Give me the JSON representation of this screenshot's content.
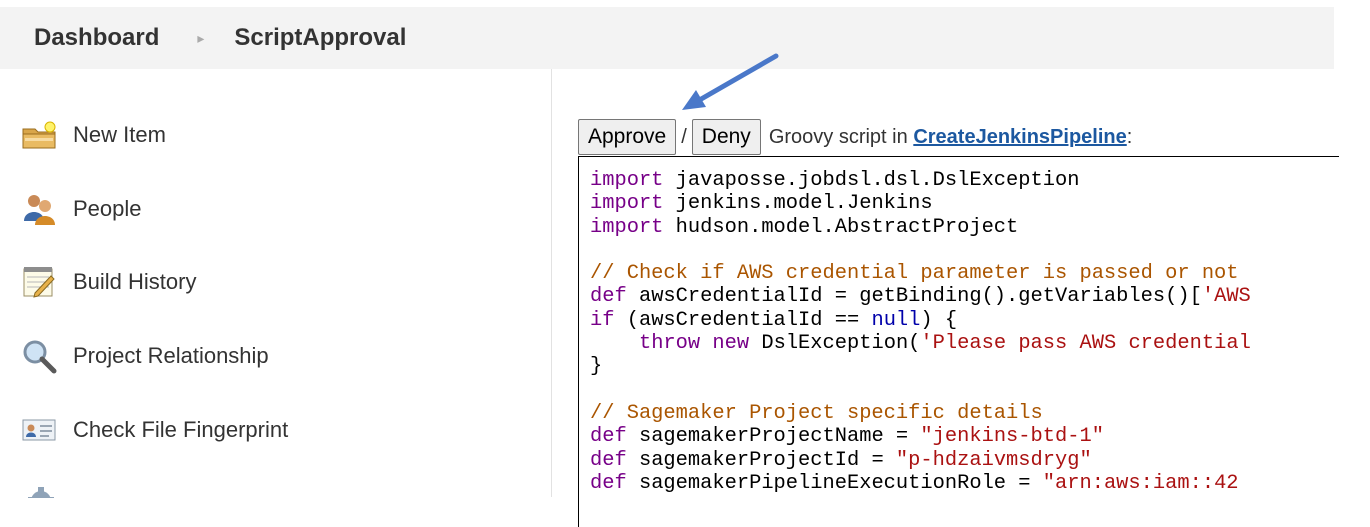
{
  "breadcrumb": {
    "home": "Dashboard",
    "separator_icon": "chevron-right-icon",
    "current": "ScriptApproval"
  },
  "sidebar": {
    "items": [
      {
        "label": "New Item",
        "icon": "folder-new-icon"
      },
      {
        "label": "People",
        "icon": "people-icon"
      },
      {
        "label": "Build History",
        "icon": "notepad-icon"
      },
      {
        "label": "Project Relationship",
        "icon": "magnifier-icon"
      },
      {
        "label": "Check File Fingerprint",
        "icon": "fingerprint-card-icon"
      }
    ]
  },
  "approval": {
    "approve_label": "Approve",
    "separator": "/",
    "deny_label": "Deny",
    "description_prefix": "Groovy script in",
    "script_name": "CreateJenkinsPipeline",
    "description_suffix": ":",
    "arrow_color": "#4a78c9"
  },
  "code": {
    "lines": [
      "import javaposse.jobdsl.dsl.DslException",
      "import jenkins.model.Jenkins",
      "import hudson.model.AbstractProject",
      "",
      "// Check if AWS credential parameter is passed or not",
      "def awsCredentialId = getBinding().getVariables()['AWS",
      "if (awsCredentialId == null) {",
      "    throw new DslException('Please pass AWS credential",
      "}",
      "",
      "// Sagemaker Project specific details",
      "def sagemakerProjectName = \"jenkins-btd-1\"",
      "def sagemakerProjectId = \"p-hdzaivmsdryg\"",
      "def sagemakerPipelineExecutionRole = \"arn:aws:iam::42"
    ]
  },
  "colors": {
    "keyword": "#770088",
    "comment": "#aa5500",
    "string": "#aa1111",
    "link": "#1c58a0"
  }
}
